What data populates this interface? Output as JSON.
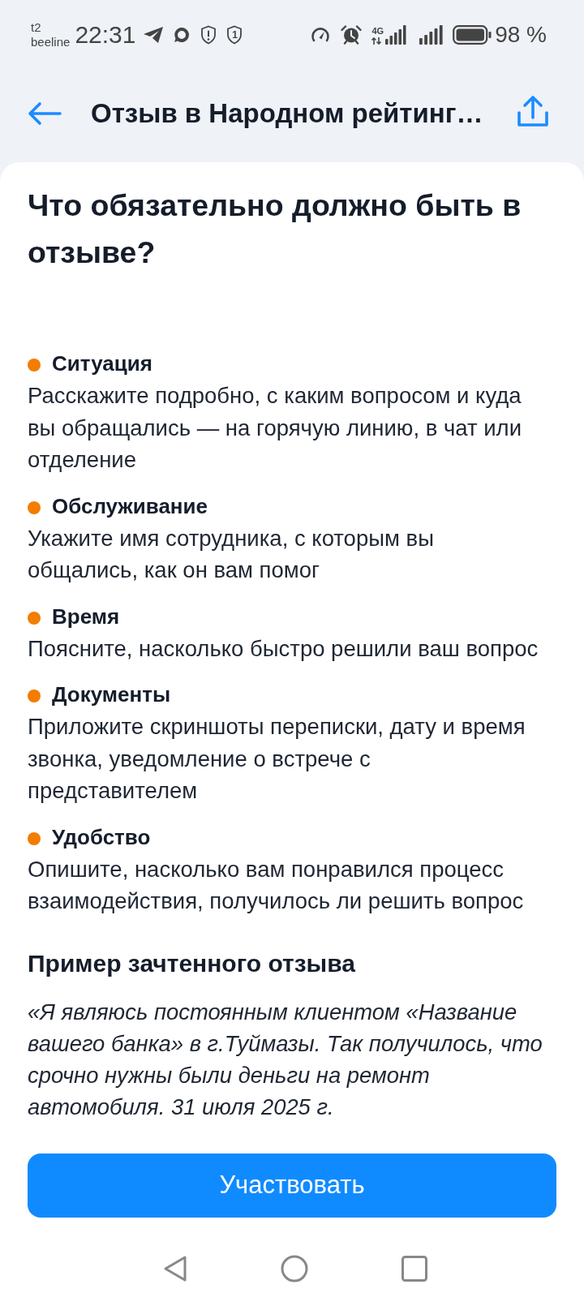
{
  "status_bar": {
    "carrier_top": "t2",
    "carrier_bottom": "beeline",
    "time": "22:31",
    "shield_badge": "1",
    "network_type": "4G",
    "battery": "98 %"
  },
  "header": {
    "title": "Отзыв в Народном рейтинг…"
  },
  "heading": "Что обязательно должно быть в отзыве?",
  "items": [
    {
      "title": "Ситуация",
      "description": "Расскажите подробно, с каким вопросом и куда вы обращались — на горячую линию, в чат или отделение"
    },
    {
      "title": "Обслуживание",
      "description": "Укажите имя сотрудника, с которым вы общались, как он вам помог"
    },
    {
      "title": "Время",
      "description": "Поясните, насколько быстро решили ваш вопрос"
    },
    {
      "title": "Документы",
      "description": "Приложите скриншоты переписки, дату и время звонка, уведомление о встрече с представителем"
    },
    {
      "title": "Удобство",
      "description": "Опишите, насколько вам понравился процесс взаимодействия, получилось ли решить вопрос"
    }
  ],
  "example": {
    "title": "Пример зачтенного отзыва",
    "quote": "«Я являюсь постоянным клиентом «Название вашего банка» в г.Туймазы. Так получилось, что срочно нужны были деньги на ремонт автомобиля. 31 июля 2025 г."
  },
  "button": {
    "label": "Участвовать"
  }
}
